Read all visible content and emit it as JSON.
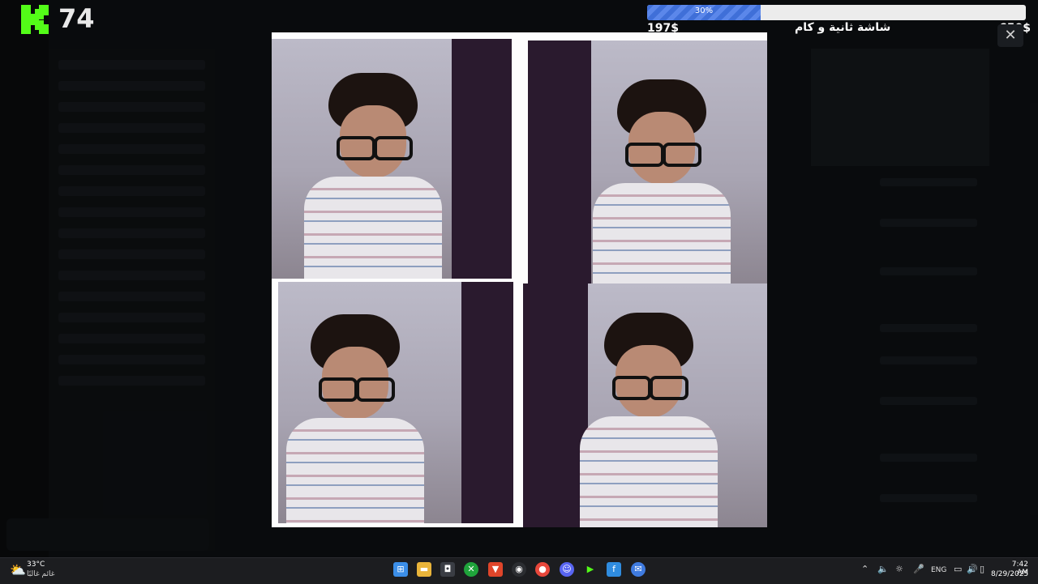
{
  "overlay": {
    "viewer_count": "74",
    "goal": {
      "percent_label": "30%",
      "progress": 0.3,
      "current": "197$",
      "title": "شاشة ثانية و كام",
      "target": "650$"
    }
  },
  "viewer": {
    "close_label": "✕"
  },
  "taskbar": {
    "weather": {
      "temp": "33°C",
      "desc": "غائم غالبًا",
      "icon": "weather-partly-cloudy-icon"
    },
    "tray": {
      "lang": "ENG"
    },
    "clock": {
      "time": "7:42 AM",
      "date": "8/29/2025"
    }
  },
  "colors": {
    "kick_green": "#53fc18",
    "goal_fill": "#4a78de",
    "taskbar_bg": "#1c1d20"
  }
}
